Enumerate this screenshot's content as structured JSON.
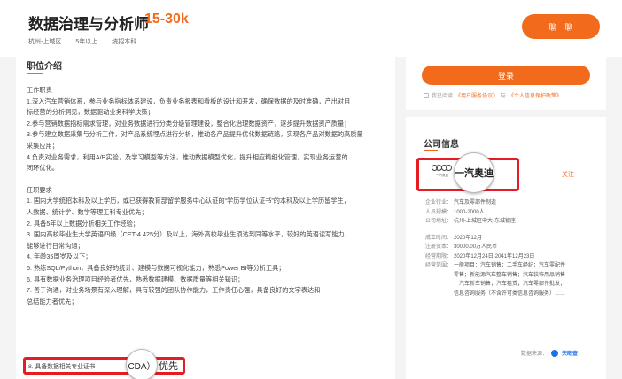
{
  "header": {
    "job_title": "数据治理与分析师",
    "salary": "15-30k",
    "location": "杭州-上城区",
    "experience": "5年以上",
    "education": "统招本科",
    "apply_button": "聊一聊"
  },
  "job": {
    "section_title": "职位介绍",
    "lines": [
      "工作职责",
      "1.深入汽车营销体系，参与业务指标体系建设，负责业务报表和看板的设计和开发，确保数据的及时准确，产出对目",
      "标经营的分析洞见，数据驱动业务科学决策；",
      "2.参与营销数据指标需求管理，对业务数据进行分类分级管理建设，整合化治理数据资产，逐步提升数据资产质量；",
      "3.参与建立数据采集与分析工作，对产品系统埋点进行分析，推动各产品提升优化数据链路，实现各产品对数据的高质量",
      "采集应用；",
      "4.负责对业务需求，利用A/B实验，及学习模型等方法，推动数据模型优化，提升相应精细化管理，实现业务运营的",
      "闭环优化。",
      "",
      "任职要求",
      "1. 国内大学统招本科及以上学历，或已获得教育部留学服务中心认证的“学历学位认证书”的本科及以上学历留学生，",
      "人数据、统计学、数学等理工科专业优先；",
      "2. 具备5年以上数据分析相关工作经验；",
      "3. 国内高校毕业生大学英语四级（CET-4 425分）及以上，海外高校毕业生须达到同等水平，较好的英语读写能力，",
      "能够进行日常沟通；",
      "4. 年龄35周岁及以下；",
      "5. 熟练SQL/Python，具备良好的统计、建模与数据可视化能力，熟悉Power BI等分析工具；",
      "6. 具有数据业务治理项目经验者优先，熟悉数据建模、数据质量等相关知识；",
      "7. 善于沟通，对业务场景有深入理解，具有较强的团队协作能力，工作责任心强，具备良好的文字表达和",
      "总结能力者优先；"
    ],
    "highlight_prefix": "8. 具备数据相关专业证书",
    "highlight_lens": "CDA）",
    "highlight_suffix": "优先"
  },
  "login": {
    "button": "登录",
    "agree_prefix": "我已阅读",
    "agree_link1": "《用户服务协议》",
    "agree_mid": "与",
    "agree_link2": "《个人信息保护政策》"
  },
  "company": {
    "section_title": "公司信息",
    "logo_caption": "一汽奥迪",
    "lens_name": "一汽奥迪",
    "follow": "关注",
    "rows": [
      {
        "k": "企业行业：",
        "v": "汽车及零部件制造"
      },
      {
        "k": "人员规模：",
        "v": "1000-2000人"
      },
      {
        "k": "公司地址：",
        "v": "杭州-上城区中大·东城银座"
      },
      {
        "k": "成立时间：",
        "v": "2020年12月"
      },
      {
        "k": "注册资本：",
        "v": "30000.00万人民币"
      },
      {
        "k": "经营期限：",
        "v": "2020年12月24日-2041年12月23日"
      },
      {
        "k": "经营范围：",
        "v": "一般项目：汽车销售；二手车经纪；汽车零配件"
      },
      {
        "k": "",
        "v": "零售；新能源汽车整车销售；汽车装饰用品销售"
      },
      {
        "k": "",
        "v": "；汽车新车销售；汽车租赁；汽车零部件批发；"
      },
      {
        "k": "",
        "v": "信息咨询服务（不含许可类信息咨询服务）……"
      }
    ],
    "source_label": "数据来源：",
    "source_name": "天眼查"
  }
}
